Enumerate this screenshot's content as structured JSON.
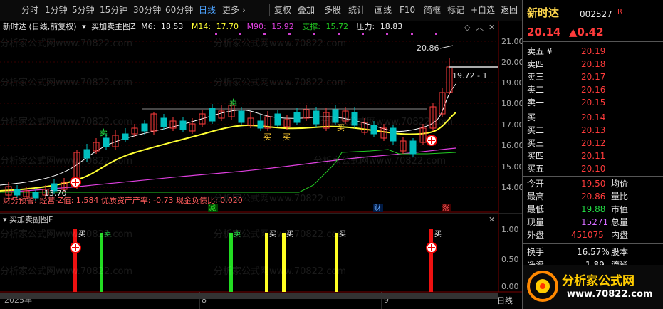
{
  "toolbar": {
    "left_items": [
      "分时",
      "1分钟",
      "5分钟",
      "15分钟",
      "30分钟",
      "60分钟",
      "日线",
      "更多 ›"
    ],
    "selected": "日线",
    "right_items": [
      "复权",
      "叠加",
      "多股",
      "统计",
      "画线",
      "F10",
      "简框",
      "标记",
      "+自选",
      "返回"
    ]
  },
  "chart": {
    "stock_label": "新时达 (日线,前复权)",
    "indicator_main": "买加卖主图Z",
    "m6_label": "M6:",
    "m6_value": "18.53",
    "m14_label": "M14:",
    "m14_value": "17.70",
    "m90_label": "M90:",
    "m90_value": "15.92",
    "support_label": "支撑:",
    "support_value": "15.72",
    "pressure_label": "压力:",
    "pressure_value": "18.83",
    "high_mark": "20.86",
    "low_mark": "13.70",
    "cursor_price": "19.72 - 1",
    "finance_label": "财务预警: 经营-Z值: 1.584 优质资产产率: -0.73 现金负债比: 0.020",
    "event_tags": [
      "减",
      "财",
      "涨"
    ],
    "sub_indicator": "买加卖副图F",
    "y_ticks": [
      "21.00",
      "20.00",
      "19.00",
      "18.00",
      "17.00",
      "16.00",
      "15.00",
      "14.00"
    ],
    "sub_y_ticks": [
      "1.00",
      "0.50",
      "0.00"
    ],
    "x_labels": [
      "2025年",
      "8",
      "9"
    ],
    "period": "日线",
    "sell_label": "卖",
    "buy_label": "买",
    "colors": {
      "up": "#ff3b3b",
      "down": "#00c0c0",
      "m6": "#ffffff",
      "m14": "#ffff33",
      "m90": "#e040e0",
      "support": "#22cc22"
    }
  },
  "watermark": "分析家公式网www.70822.com",
  "panel": {
    "name": "新时达",
    "code": "002527",
    "badge": "R",
    "price": "20.14",
    "change": "▲0.42",
    "asks": [
      {
        "label": "卖五 ¥",
        "price": "20.19"
      },
      {
        "label": "卖四",
        "price": "20.18"
      },
      {
        "label": "卖三",
        "price": "20.17"
      },
      {
        "label": "卖二",
        "price": "20.16"
      },
      {
        "label": "卖一",
        "price": "20.15"
      }
    ],
    "bids": [
      {
        "label": "买一",
        "price": "20.14"
      },
      {
        "label": "买二",
        "price": "20.13"
      },
      {
        "label": "买三",
        "price": "20.12"
      },
      {
        "label": "买四",
        "price": "20.11"
      },
      {
        "label": "买五",
        "price": "20.10"
      }
    ],
    "stats": [
      {
        "k": "今开",
        "v": "19.50",
        "k2": "均价"
      },
      {
        "k": "最高",
        "v": "20.86",
        "k2": "量比"
      },
      {
        "k": "最低",
        "v": "19.88",
        "k2": "市值"
      },
      {
        "k": "现量",
        "v": "15271",
        "k2": "总量"
      },
      {
        "k": "外盘",
        "v": "451075",
        "k2": "内盘"
      }
    ],
    "turnover_label": "换手",
    "turnover": "16.57%",
    "equity_label": "股本",
    "ratio_label": "净资",
    "ratio": "1.89",
    "flow_label": "流通",
    "logo_text": "分析家公式网",
    "logo_url": "www.70822.com"
  }
}
